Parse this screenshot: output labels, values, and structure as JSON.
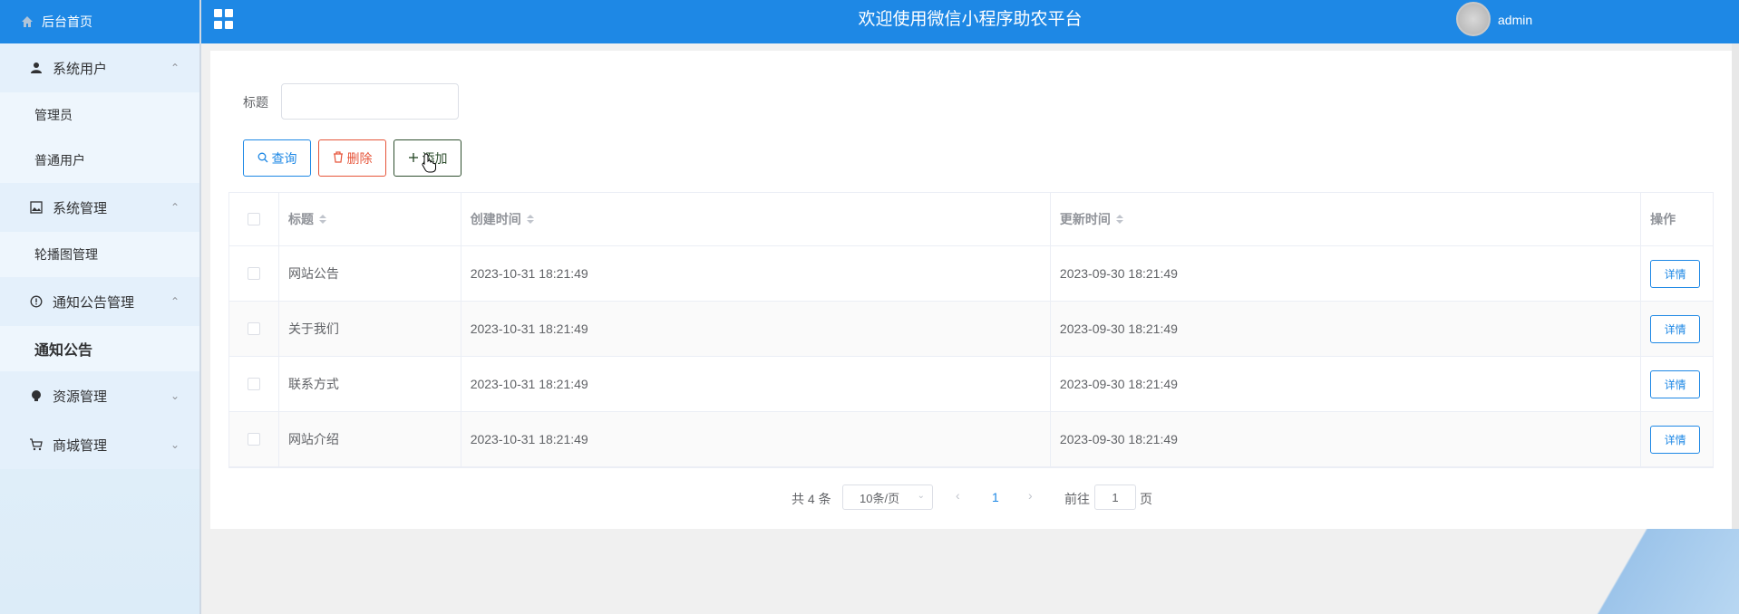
{
  "header": {
    "title": "欢迎使用微信小程序助农平台",
    "username": "admin"
  },
  "sidebar": {
    "home": "后台首页",
    "groups": [
      {
        "label": "系统用户",
        "icon": "user-icon",
        "items": [
          "管理员",
          "普通用户"
        ]
      },
      {
        "label": "系统管理",
        "icon": "image-icon",
        "items": [
          "轮播图管理"
        ]
      },
      {
        "label": "通知公告管理",
        "icon": "info-circle-icon",
        "items": [
          "通知公告"
        ]
      },
      {
        "label": "资源管理",
        "icon": "bulb-icon",
        "items": []
      },
      {
        "label": "商城管理",
        "icon": "cart-icon",
        "items": []
      }
    ]
  },
  "search": {
    "label": "标题",
    "value": ""
  },
  "buttons": {
    "query": "查询",
    "delete": "删除",
    "add": "添加"
  },
  "table": {
    "columns": [
      "标题",
      "创建时间",
      "更新时间",
      "操作"
    ],
    "detail_label": "详情",
    "rows": [
      {
        "title": "网站公告",
        "created": "2023-10-31 18:21:49",
        "updated": "2023-09-30 18:21:49"
      },
      {
        "title": "关于我们",
        "created": "2023-10-31 18:21:49",
        "updated": "2023-09-30 18:21:49"
      },
      {
        "title": "联系方式",
        "created": "2023-10-31 18:21:49",
        "updated": "2023-09-30 18:21:49"
      },
      {
        "title": "网站介绍",
        "created": "2023-10-31 18:21:49",
        "updated": "2023-09-30 18:21:49"
      }
    ]
  },
  "pagination": {
    "total": "共 4 条",
    "page_size": "10条/页",
    "current": "1",
    "goto": "前往",
    "goto_value": "1",
    "page_unit": "页"
  },
  "colors": {
    "primary": "#1e88e5",
    "danger": "#e6553a",
    "success": "#2f4f2f"
  }
}
